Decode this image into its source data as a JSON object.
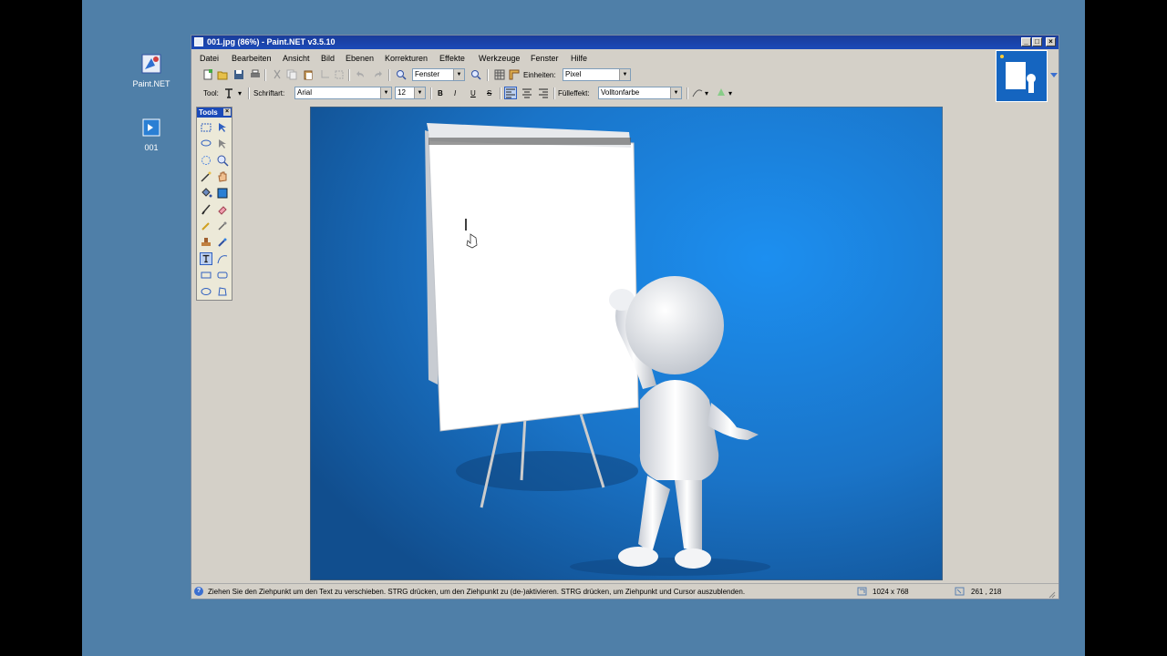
{
  "desktop": {
    "icons": [
      {
        "label": "Paint.NET"
      },
      {
        "label": "001"
      }
    ]
  },
  "window": {
    "title": "001.jpg (86%) - Paint.NET v3.5.10",
    "buttons": {
      "minimize": "_",
      "maximize": "□",
      "close": "×"
    }
  },
  "menu": [
    "Datei",
    "Bearbeiten",
    "Ansicht",
    "Bild",
    "Ebenen",
    "Korrekturen",
    "Effekte",
    "Werkzeuge",
    "Fenster",
    "Hilfe"
  ],
  "toolbar1": {
    "zoom_value": "Fenster",
    "units_label": "Einheiten:",
    "units_value": "Pixel"
  },
  "toolbar2": {
    "tool_label": "Tool:",
    "font_label": "Schriftart:",
    "font_value": "Arial",
    "size_value": "12",
    "bold": "B",
    "italic": "I",
    "underline": "U",
    "strike": "S",
    "fill_label": "Fülleffekt:",
    "fill_value": "Volltonfarbe"
  },
  "tools_panel": {
    "title": "Tools",
    "close": "×"
  },
  "status": {
    "message": "Ziehen Sie den Ziehpunkt um den Text zu verschieben. STRG drücken, um den Ziehpunkt zu (de-)aktivieren. STRG drücken, um Ziehpunkt und Cursor auszublenden.",
    "image_size": "1024 x 768",
    "cursor_pos": "261 , 218"
  },
  "colors": {
    "desktop": "#4f7fa8",
    "titlebar": "#1b4ab8",
    "canvas_bg": "#1f78c8"
  }
}
